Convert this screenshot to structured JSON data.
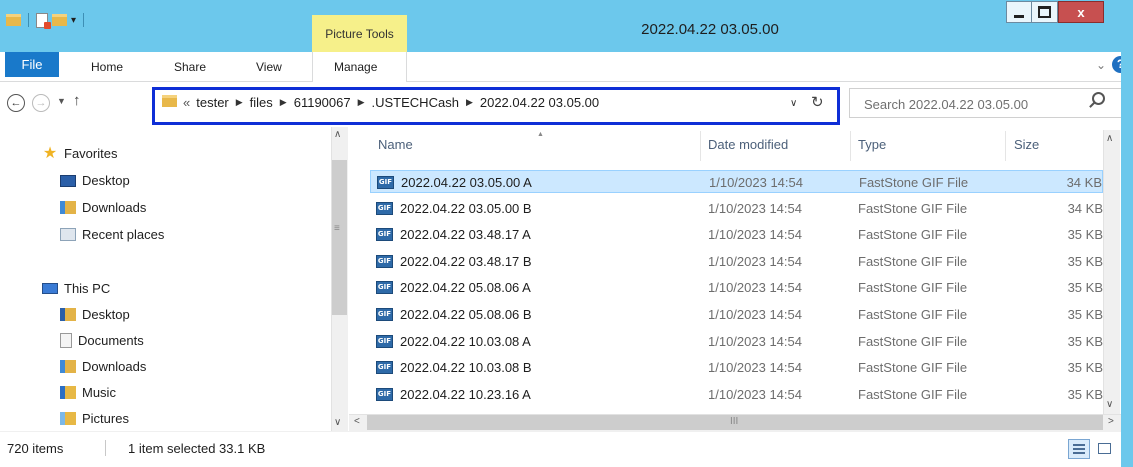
{
  "titlebar": {
    "title": "2022.04.22 03.05.00",
    "context_tab": "Picture Tools",
    "controls": {
      "minimize": "minimize",
      "maximize": "maximize",
      "close": "x"
    }
  },
  "ribbon": {
    "tabs": [
      "File",
      "Home",
      "Share",
      "View",
      "Manage"
    ]
  },
  "address": {
    "overflow": "«",
    "crumbs": [
      "tester",
      "files",
      "61190067",
      ".USTECHCash",
      "2022.04.22 03.05.00"
    ]
  },
  "search": {
    "placeholder": "Search 2022.04.22 03.05.00"
  },
  "nav_pane": {
    "favorites_label": "Favorites",
    "favorites": [
      "Desktop",
      "Downloads",
      "Recent places"
    ],
    "pc_label": "This PC",
    "pc_items": [
      "Desktop",
      "Documents",
      "Downloads",
      "Music",
      "Pictures"
    ]
  },
  "columns": {
    "name": "Name",
    "date": "Date modified",
    "type": "Type",
    "size": "Size"
  },
  "files": [
    {
      "name": "2022.04.22 03.05.00 A",
      "date": "1/10/2023 14:54",
      "type": "FastStone GIF File",
      "size": "34 KB",
      "selected": true
    },
    {
      "name": "2022.04.22 03.05.00 B",
      "date": "1/10/2023 14:54",
      "type": "FastStone GIF File",
      "size": "34 KB"
    },
    {
      "name": "2022.04.22 03.48.17 A",
      "date": "1/10/2023 14:54",
      "type": "FastStone GIF File",
      "size": "35 KB"
    },
    {
      "name": "2022.04.22 03.48.17 B",
      "date": "1/10/2023 14:54",
      "type": "FastStone GIF File",
      "size": "35 KB"
    },
    {
      "name": "2022.04.22 05.08.06 A",
      "date": "1/10/2023 14:54",
      "type": "FastStone GIF File",
      "size": "35 KB"
    },
    {
      "name": "2022.04.22 05.08.06 B",
      "date": "1/10/2023 14:54",
      "type": "FastStone GIF File",
      "size": "35 KB"
    },
    {
      "name": "2022.04.22 10.03.08 A",
      "date": "1/10/2023 14:54",
      "type": "FastStone GIF File",
      "size": "35 KB"
    },
    {
      "name": "2022.04.22 10.03.08 B",
      "date": "1/10/2023 14:54",
      "type": "FastStone GIF File",
      "size": "35 KB"
    },
    {
      "name": "2022.04.22 10.23.16 A",
      "date": "1/10/2023 14:54",
      "type": "FastStone GIF File",
      "size": "35 KB"
    }
  ],
  "status": {
    "count": "720 items",
    "selection": "1 item selected  33.1 KB"
  },
  "colors": {
    "titlebar": "#6cc8ec",
    "file_tab": "#1979ca",
    "context_tab": "#f6f08a",
    "selection": "#cce8ff",
    "address_highlight": "#0e2ed6",
    "close": "#c75050"
  },
  "icons": [
    "folder-icon",
    "save-icon",
    "new-folder-icon",
    "dropdown-icon",
    "back-icon",
    "forward-icon",
    "up-icon",
    "refresh-icon",
    "search-icon",
    "help-icon",
    "star-icon",
    "gif-file-icon"
  ]
}
